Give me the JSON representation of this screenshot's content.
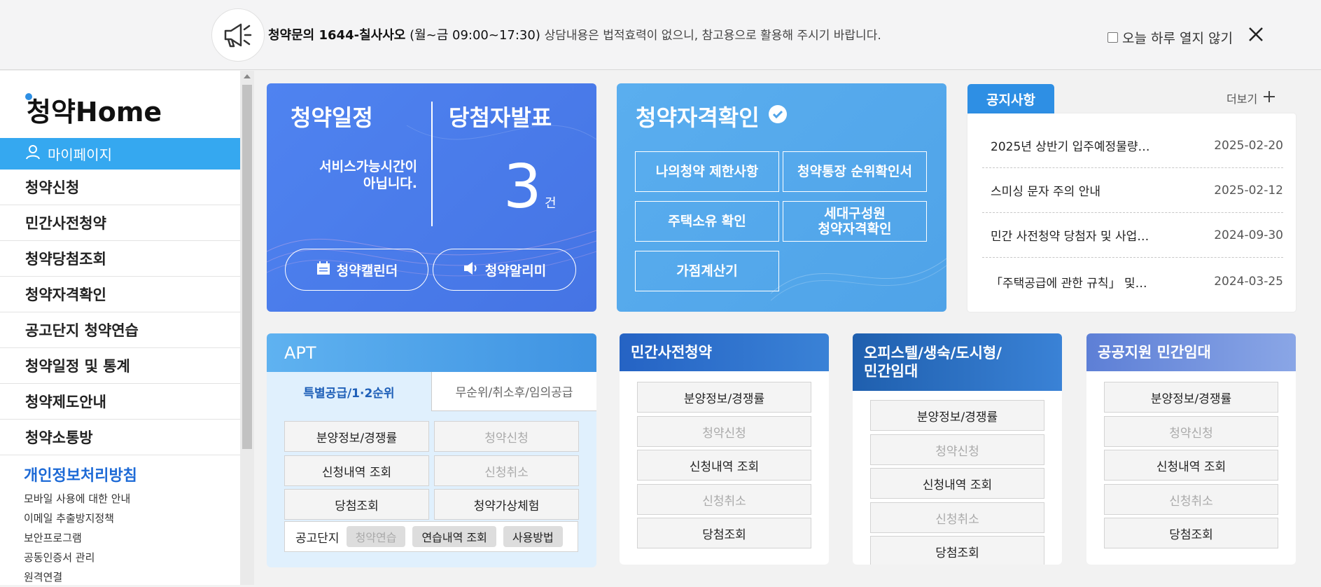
{
  "notice_bar": {
    "label": "청약문의 1644-칠사사오",
    "hours": "(월~금 09:00~17:30)",
    "disclaimer": "상담내용은 법적효력이 없으니, 참고용으로 활용해 주시기 바랍니다.",
    "dont_show_today": "오늘 하루 열지 않기"
  },
  "sidebar": {
    "logo": "청약Home",
    "mypage": "마이페이지",
    "menu": [
      "청약신청",
      "민간사전청약",
      "청약당첨조회",
      "청약자격확인",
      "공고단지 청약연습",
      "청약일정 및 통계",
      "청약제도안내",
      "청약소통방"
    ],
    "policy": "개인정보처리방침",
    "links": [
      "모바일 사용에 대한 안내",
      "이메일 추출방지정책",
      "보안프로그램",
      "공동인증서 관리",
      "원격연결"
    ]
  },
  "schedule_card": {
    "title": "청약일정",
    "winners_title": "당첨자발표",
    "unavailable_line1": "서비스가능시간이",
    "unavailable_line2": "아닙니다.",
    "winner_count": "3",
    "winner_unit": "건",
    "calendar_button": "청약캘린더",
    "alarm_button": "청약알리미"
  },
  "eligibility_card": {
    "title": "청약자격확인",
    "buttons": [
      "나의청약 제한사항",
      "청약통장 순위확인서",
      "주택소유 확인",
      "세대구성원",
      "청약자격확인",
      "가점계산기"
    ]
  },
  "notices": {
    "tab": "공지사항",
    "more": "더보기",
    "items": [
      {
        "title": "2025년 상반기 입주예정물량…",
        "date": "2025-02-20"
      },
      {
        "title": "스미싱 문자 주의 안내",
        "date": "2025-02-12"
      },
      {
        "title": "민간 사전청약 당첨자 및 사업…",
        "date": "2024-09-30"
      },
      {
        "title": "「주택공급에 관한 규칙」 및…",
        "date": "2024-03-25"
      }
    ]
  },
  "apt": {
    "title": "APT",
    "tab_active": "특별공급/1·2순위",
    "tab_inactive": "무순위/취소후/임의공급",
    "buttons": [
      "분양정보/경쟁률",
      "청약신청",
      "신청내역 조회",
      "신청취소",
      "당첨조회",
      "청약가상체험"
    ],
    "foot_label": "공고단지",
    "chips": [
      "청약연습",
      "연습내역 조회",
      "사용방법"
    ]
  },
  "private_pre": {
    "title": "민간사전청약",
    "buttons": [
      "분양정보/경쟁률",
      "청약신청",
      "신청내역 조회",
      "신청취소",
      "당첨조회"
    ]
  },
  "officetel": {
    "title_line1": "오피스텔/생숙/도시형/",
    "title_line2": "민간임대",
    "buttons": [
      "분양정보/경쟁률",
      "청약신청",
      "신청내역 조회",
      "신청취소",
      "당첨조회"
    ]
  },
  "public_rental": {
    "title": "공공지원 민간임대",
    "buttons": [
      "분양정보/경쟁률",
      "청약신청",
      "신청내역 조회",
      "신청취소",
      "당첨조회"
    ]
  },
  "colors": {
    "accent_blue": "#35a8f0",
    "schedule_card": "#4f83f0",
    "eligibility_card": "#5aaeef",
    "notice_tab": "#2e8fe4",
    "policy_link": "#1d6ad6"
  }
}
